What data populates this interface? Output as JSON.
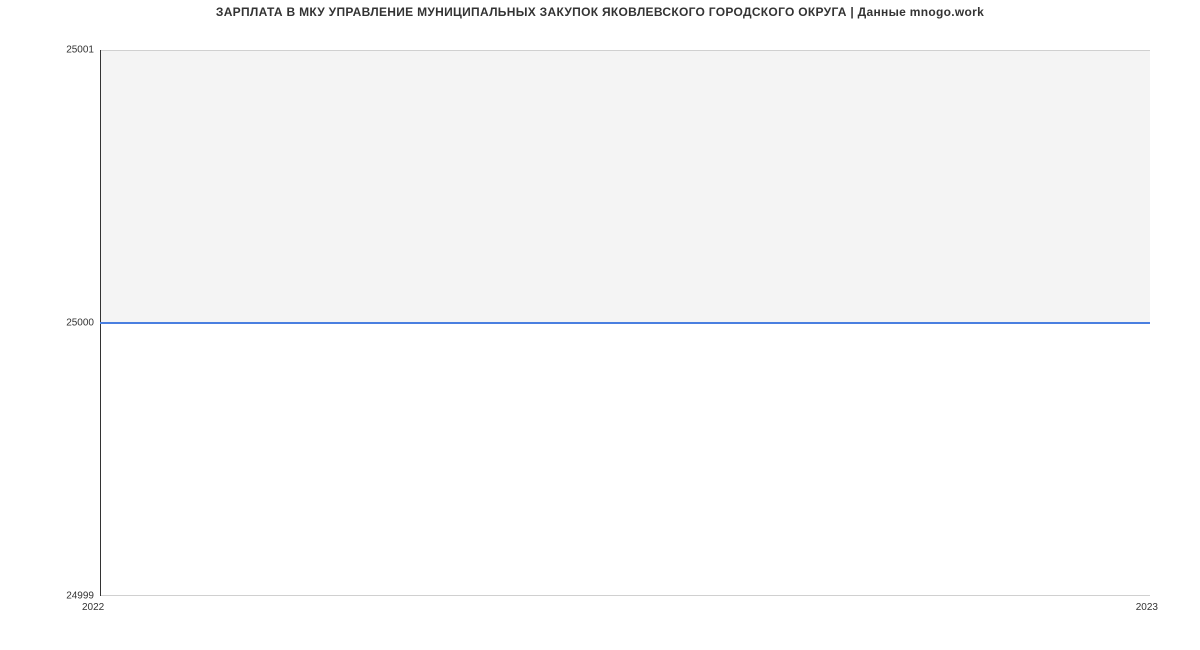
{
  "chart_data": {
    "type": "line",
    "title": "ЗАРПЛАТА В МКУ УПРАВЛЕНИЕ МУНИЦИПАЛЬНЫХ ЗАКУПОК ЯКОВЛЕВСКОГО ГОРОДСКОГО ОКРУГА | Данные mnogo.work",
    "x": [
      2022,
      2023
    ],
    "values": [
      25000,
      25000
    ],
    "xlabel": "",
    "ylabel": "",
    "xlim": [
      2022,
      2023
    ],
    "ylim": [
      24999,
      25001
    ],
    "x_ticks": [
      "2022",
      "2023"
    ],
    "y_ticks": [
      "24999",
      "25000",
      "25001"
    ],
    "line_color": "#4a7fe0"
  }
}
